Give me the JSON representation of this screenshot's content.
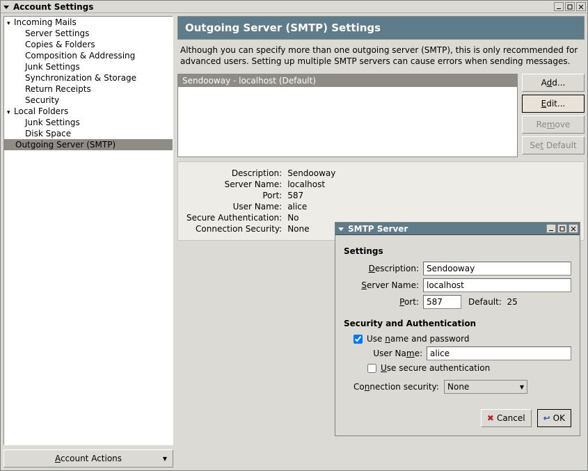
{
  "window": {
    "title": "Account Settings"
  },
  "sidebar": {
    "groups": [
      {
        "label": "Incoming Mails",
        "expanded": true,
        "items": [
          "Server Settings",
          "Copies & Folders",
          "Composition & Addressing",
          "Junk Settings",
          "Synchronization & Storage",
          "Return Receipts",
          "Security"
        ]
      },
      {
        "label": "Local Folders",
        "expanded": true,
        "items": [
          "Junk Settings",
          "Disk Space"
        ]
      }
    ],
    "selected": "Outgoing Server (SMTP)",
    "account_actions": "Account Actions"
  },
  "content": {
    "header": "Outgoing Server (SMTP) Settings",
    "description": "Although you can specify more than one outgoing server (SMTP), this is only recommended for advanced users. Setting up multiple SMTP servers can cause errors when sending messages.",
    "list_item": "Sendooway - localhost (Default)",
    "buttons": {
      "add": "Add...",
      "edit": "Edit...",
      "remove": "Remove",
      "set_default": "Set Default"
    },
    "details": {
      "labels": {
        "description": "Description:",
        "server_name": "Server Name:",
        "port": "Port:",
        "user_name": "User Name:",
        "secure_auth": "Secure Authentication:",
        "conn_sec": "Connection Security:"
      },
      "values": {
        "description": "Sendooway",
        "server_name": "localhost",
        "port": "587",
        "user_name": "alice",
        "secure_auth": "No",
        "conn_sec": "None"
      }
    }
  },
  "dialog": {
    "title": "SMTP Server",
    "sections": {
      "settings": "Settings",
      "security": "Security and Authentication"
    },
    "labels": {
      "description": "Description:",
      "server_name": "Server Name:",
      "port": "Port:",
      "default_hint": "Default:",
      "default_port": "25",
      "use_name_pwd": "Use name and password",
      "user_name": "User Name:",
      "use_secure_auth": "Use secure authentication",
      "conn_sec": "Connection security:"
    },
    "values": {
      "description": "Sendooway",
      "server_name": "localhost",
      "port": "587",
      "use_name_pwd": true,
      "user_name": "alice",
      "use_secure_auth": false,
      "conn_sec": "None"
    },
    "buttons": {
      "cancel": "Cancel",
      "ok": "OK"
    }
  }
}
